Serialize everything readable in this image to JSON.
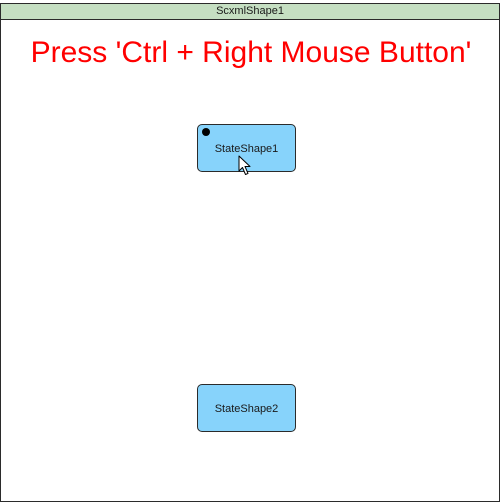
{
  "container": {
    "title": "ScxmlShape1",
    "header_color": "#c5dfc2"
  },
  "instruction": {
    "text": "Press 'Ctrl + Right Mouse Button'",
    "color": "#ff0000"
  },
  "states": [
    {
      "label": "StateShape1",
      "fill": "#87d3fb",
      "initial_marker": true
    },
    {
      "label": "StateShape2",
      "fill": "#87d3fb",
      "initial_marker": false
    }
  ],
  "cursor": {
    "icon": "arrow-cursor-icon"
  }
}
